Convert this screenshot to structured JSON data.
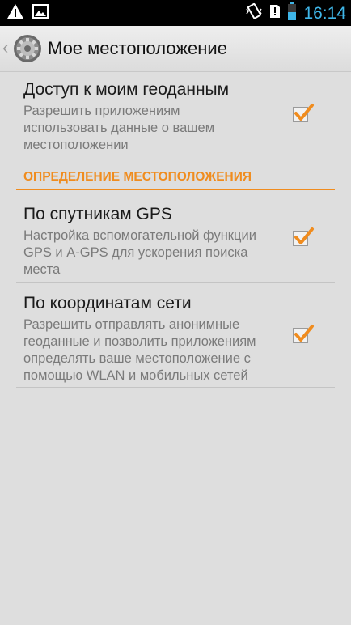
{
  "status_bar": {
    "time": "16:14",
    "left_icons": [
      "warning-icon",
      "image-icon"
    ],
    "right_icons": [
      "vibrate-icon",
      "notification-alert-icon",
      "battery-icon"
    ],
    "accent_color": "#3fb6e8"
  },
  "action_bar": {
    "title": "Мое местоположение",
    "back_icon": "chevron-left-icon",
    "app_icon": "settings-gear-icon"
  },
  "preferences": [
    {
      "title": "Доступ к моим геоданным",
      "summary": "Разрешить приложениям использовать данные о вашем местоположении",
      "checked": true
    },
    {
      "title": "По спутникам GPS",
      "summary": "Настройка вспомогательной функции GPS и A-GPS для ускорения поиска места",
      "checked": true
    },
    {
      "title": "По координатам сети",
      "summary": "Разрешить отправлять анонимные геоданные и позволить приложениям определять ваше местоположение с помощью WLAN и мобильных сетей",
      "checked": true
    }
  ],
  "category": {
    "label": "ОПРЕДЕЛЕНИЕ МЕСТОПОЛОЖЕНИЯ",
    "color": "#f08c1e"
  },
  "check_color": "#f08c1e"
}
